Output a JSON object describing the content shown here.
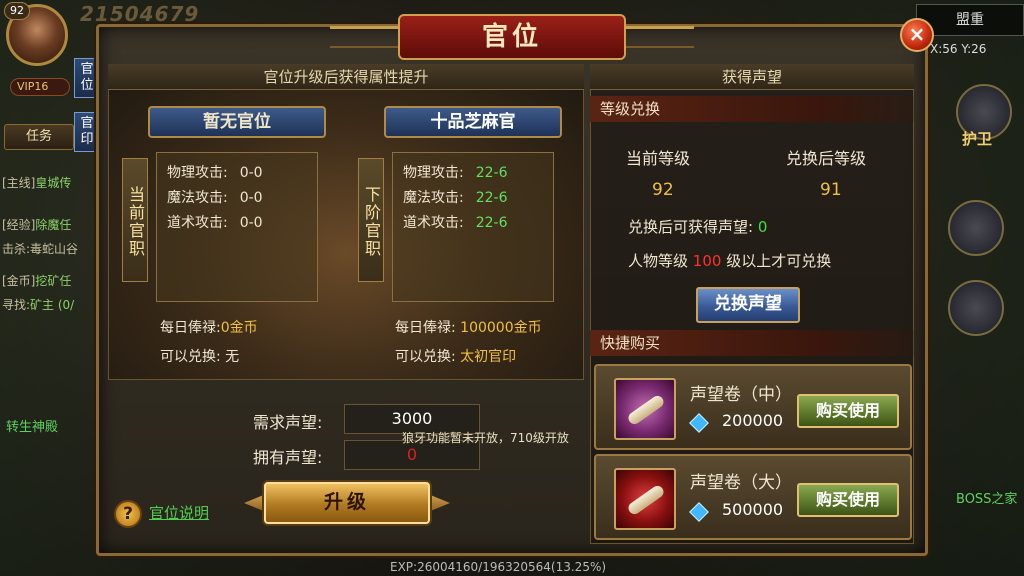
{
  "hud": {
    "level": "92",
    "power": "21504679",
    "vip": "VIP16",
    "tab_rank": "官位",
    "tab_seal": "官印",
    "task_button": "任务",
    "quests": [
      {
        "tag": "[主线]",
        "text": "皇城传"
      },
      {
        "tag": "[经验]",
        "text": "除魔任"
      },
      {
        "tag": "击杀:",
        "text": "毒蛇山谷"
      },
      {
        "tag": "[金币]",
        "text": "挖矿任"
      },
      {
        "tag": "寻找:",
        "text": "矿主 (0/"
      }
    ],
    "alliance": "盟重",
    "coords": "X:56 Y:26",
    "guard": "护卫",
    "rebirth": "转生神殿",
    "boss": "BOSS之家",
    "exp": "EXP:26004160/196320564(13.25%)"
  },
  "dialog": {
    "title": "官位",
    "close": "×",
    "left": {
      "header": "官位升级后获得属性提升",
      "current": {
        "rank_name": "暂无官位",
        "side_label": "当前官职",
        "stats": [
          {
            "name": "物理攻击:",
            "value": "0-0"
          },
          {
            "name": "魔法攻击:",
            "value": "0-0"
          },
          {
            "name": "道术攻击:",
            "value": "0-0"
          }
        ],
        "salary_label": "每日俸禄:",
        "salary_value": "0金币",
        "exchange_label": "可以兑换:",
        "exchange_value": "无"
      },
      "next": {
        "rank_name": "十品芝麻官",
        "side_label": "下阶官职",
        "stats": [
          {
            "name": "物理攻击:",
            "value": "22-6"
          },
          {
            "name": "魔法攻击:",
            "value": "22-6"
          },
          {
            "name": "道术攻击:",
            "value": "22-6"
          }
        ],
        "salary_label": "每日俸禄:",
        "salary_value": "100000金币",
        "exchange_label": "可以兑换:",
        "exchange_value": "太初官印"
      },
      "required_label": "需求声望:",
      "required_value": "3000",
      "owned_label": "拥有声望:",
      "owned_value": "0",
      "notice": "狼牙功能暂未开放，710级开放",
      "help_icon": "?",
      "help_link": "官位说明",
      "upgrade": "升级"
    },
    "right": {
      "header": "获得声望",
      "level_section": "等级兑换",
      "current_level_label": "当前等级",
      "current_level": "92",
      "after_level_label": "兑换后等级",
      "after_level": "91",
      "obtain_label": "兑换后可获得声望:",
      "obtain_value": "0",
      "req_prefix": "人物等级",
      "req_level": "100",
      "req_suffix": "级以上才可兑换",
      "exchange_button": "兑换声望",
      "quick_section": "快捷购买",
      "items": [
        {
          "name": "声望卷（中）",
          "price": "200000",
          "button": "购买使用"
        },
        {
          "name": "声望卷（大）",
          "price": "500000",
          "button": "购买使用"
        }
      ]
    }
  }
}
